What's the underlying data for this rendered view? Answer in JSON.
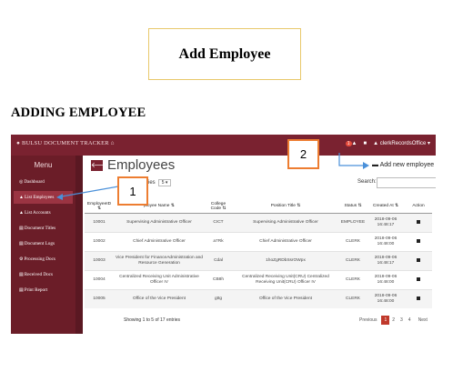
{
  "document": {
    "title": "Add Employee",
    "section_heading": "ADDING EMPLOYEE"
  },
  "app": {
    "brand": "BULSU DOCUMENT TRACKER",
    "notification_count": "1",
    "user_name": "clerkRecordsOffice",
    "menu_label": "Menu",
    "sidebar": [
      {
        "label": "Dashboard",
        "icon": "dashboard-icon",
        "active": false
      },
      {
        "label": "List Employees",
        "icon": "users-icon",
        "active": true
      },
      {
        "label": "List Accounts",
        "icon": "accounts-icon",
        "active": false
      },
      {
        "label": "Document Titles",
        "icon": "document-icon",
        "active": false
      },
      {
        "label": "Document Logs",
        "icon": "logs-icon",
        "active": false
      },
      {
        "label": "Processing Docs",
        "icon": "processing-icon",
        "active": false
      },
      {
        "label": "Received Docs",
        "icon": "received-icon",
        "active": false
      },
      {
        "label": "Print Report",
        "icon": "print-icon",
        "active": false
      }
    ],
    "page_title": "Employees",
    "add_new_label": "Add new employee",
    "entries_label": "er of entries",
    "entries_value": "5",
    "search_label": "Search:",
    "table": {
      "headers": [
        "EmployeeID",
        "ployee Name",
        "College Code",
        "Position Title",
        "Status",
        "Created At",
        "Action"
      ],
      "rows": [
        [
          "10001",
          "Supervising Administrative Officer",
          "CICT",
          "Supervising Administrative Officer",
          "EMPLOYEE",
          "2018-09-06 16:48:17"
        ],
        [
          "10002",
          "Chief Administrative Officer",
          "a7Rk",
          "Chief Administrative Officer",
          "CLERK",
          "2018-09-06 16:48:00"
        ],
        [
          "10003",
          "Vice President for FinanceAdministration and Resource Generation",
          "Cdal",
          "1hoZgRDbSsrOWpx",
          "CLERK",
          "2018-09-06 16:48:17"
        ],
        [
          "10004",
          "Centralized Receiving Unit Administrative Officer IV",
          "CB8h",
          "Centralized Receiving Unit(CRU) Centralized Receiving Unit(CRU) Officer IV",
          "CLERK",
          "2018-09-06 16:48:00"
        ],
        [
          "10005",
          "Office of the Vice President",
          "gttg",
          "Office of the Vice President",
          "CLERK",
          "2018-09-06 16:48:00"
        ]
      ]
    },
    "showing_text": "Showing 1 to 5 of 17 entries",
    "pagination": {
      "previous": "Previous",
      "pages": [
        "1",
        "2",
        "3",
        "4"
      ],
      "next": "Next"
    }
  },
  "callouts": {
    "one": "1",
    "two": "2"
  },
  "colors": {
    "brand": "#7a2230",
    "sidebar": "#6b1d28",
    "callout_border": "#ed7d31",
    "arrow": "#4a90d9"
  }
}
